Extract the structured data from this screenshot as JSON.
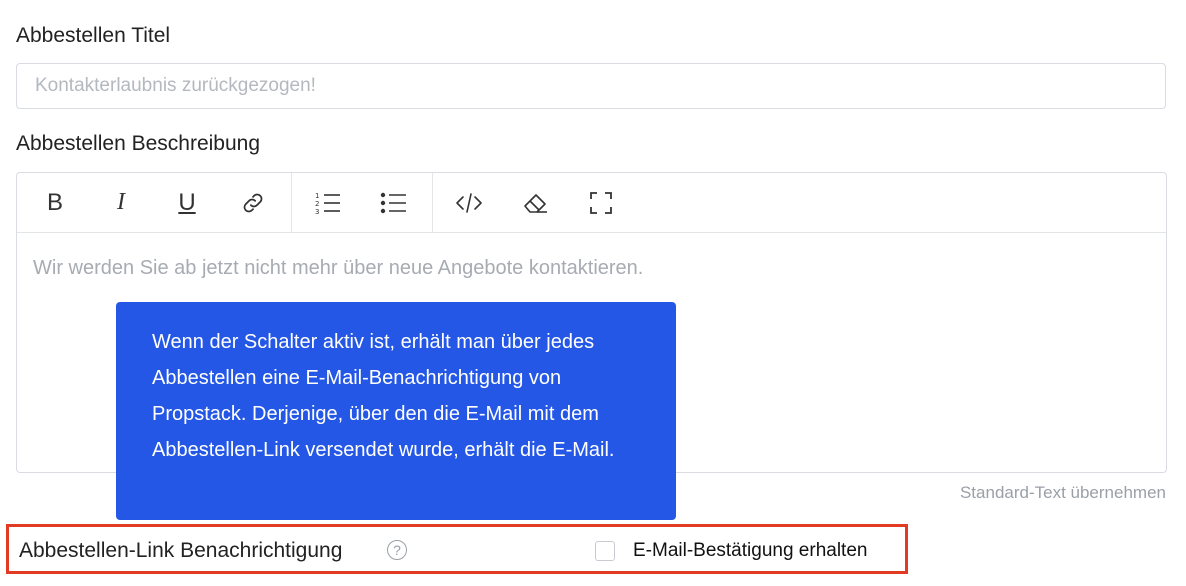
{
  "title_label": "Abbestellen Titel",
  "title_input": {
    "value": "",
    "placeholder": "Kontakterlaubnis zurückgezogen!"
  },
  "description_label": "Abbestellen Beschreibung",
  "toolbar": {
    "bold": "B",
    "italic": "I",
    "underline": "U"
  },
  "editor": {
    "placeholder": "Wir werden Sie ab jetzt nicht mehr über neue Angebote kontaktieren."
  },
  "standard_text_link": "Standard-Text übernehmen",
  "tooltip": {
    "text": "Wenn der Schalter aktiv ist, erhält man über jedes Abbestellen eine E-Mail-Benachrichtigung von Propstack. Derjenige, über den die E-Mail mit dem Abbestellen-Link versendet wurde, erhält die E-Mail."
  },
  "notification": {
    "label": "Abbestellen-Link Benachrichtigung",
    "help": "?",
    "checkbox_label": "E-Mail-Bestätigung erhalten",
    "checked": false
  },
  "colors": {
    "tooltip_bg": "#2457e5",
    "highlight_border": "#e23b23"
  }
}
